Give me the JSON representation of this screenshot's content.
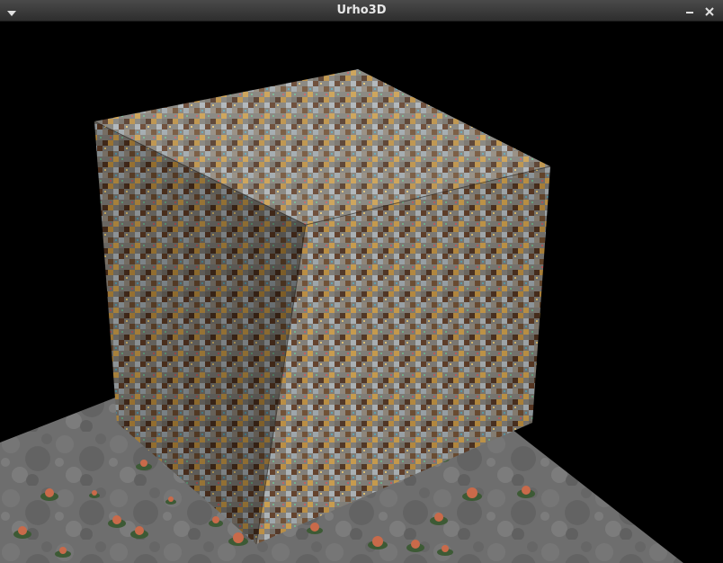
{
  "window": {
    "title": "Urho3D",
    "menu_icon": "chevron-down-icon",
    "minimize_icon": "minimize-icon",
    "close_icon": "close-icon"
  },
  "scene": {
    "objects": [
      "textured-cube",
      "stone-floor-plane",
      "mushroom-props"
    ]
  }
}
